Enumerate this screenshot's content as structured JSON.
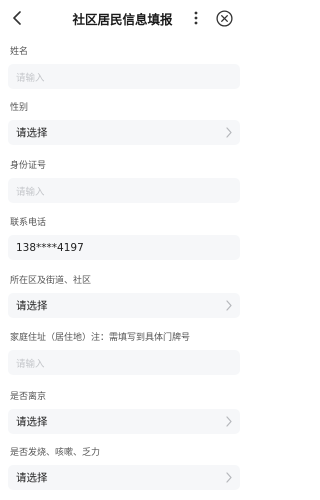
{
  "header": {
    "title": "社区居民信息填报",
    "back_icon": "chevron-left-icon",
    "more_icon": "more-vertical-icon",
    "close_icon": "close-circle-icon"
  },
  "form": {
    "fields": [
      {
        "label": "姓名",
        "type": "input",
        "placeholder": "请输入",
        "value": ""
      },
      {
        "label": "性别",
        "type": "select",
        "value": "请选择"
      },
      {
        "label": "身份证号",
        "type": "input",
        "placeholder": "请输入",
        "value": ""
      },
      {
        "label": "联系电话",
        "type": "input",
        "placeholder": "",
        "value": "138****4197"
      },
      {
        "label": "所在区及街道、社区",
        "type": "select",
        "value": "请选择"
      },
      {
        "label": "家庭住址（居住地）注：需填写到具体门牌号",
        "type": "input",
        "placeholder": "请输入",
        "value": ""
      },
      {
        "label": "是否离京",
        "type": "select",
        "value": "请选择"
      },
      {
        "label": "是否发烧、咳嗽、乏力",
        "type": "select",
        "value": "请选择"
      }
    ]
  },
  "colors": {
    "field_background": "#f6f7f9",
    "placeholder": "#c3c5c9",
    "label": "#555555",
    "text": "#222222"
  }
}
